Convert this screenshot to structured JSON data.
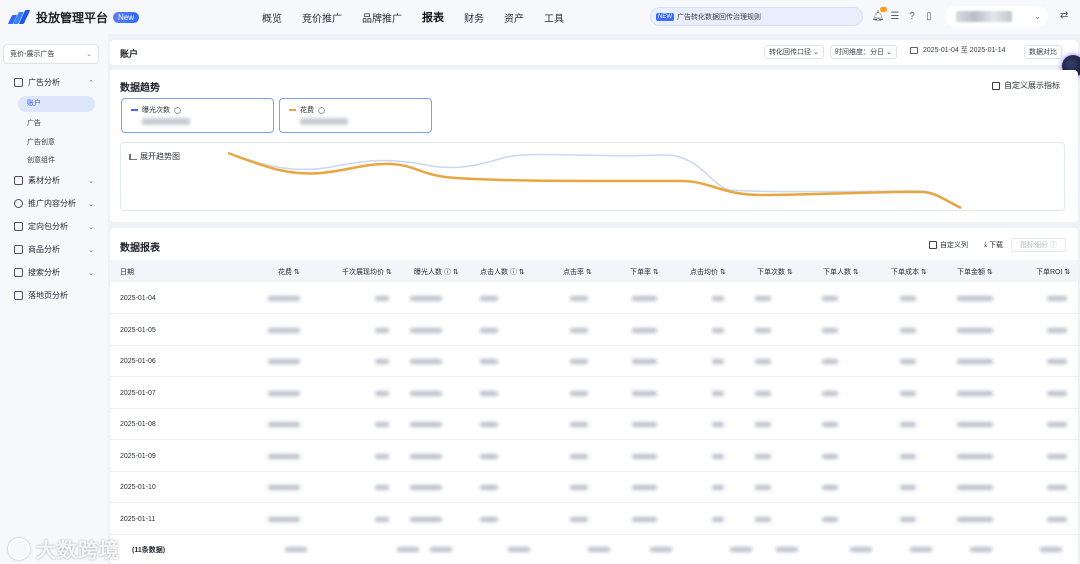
{
  "topbar": {
    "platform_name": "投放管理平台",
    "badge": "New",
    "nav": [
      "概览",
      "竞价推广",
      "品牌推广",
      "报表",
      "财务",
      "资产",
      "工具"
    ],
    "active_nav": "报表",
    "notice_tag": "NEW",
    "notice_text": "广告转化数据回传治理规则"
  },
  "sidebar": {
    "select_value": "竞价-展示广告",
    "groups": {
      "ad_analysis": "广告分析",
      "material_analysis": "素材分析",
      "content_analysis": "推广内容分析",
      "package_analysis": "定向包分析",
      "product_analysis": "商品分析",
      "search_analysis": "搜索分析",
      "landing_analysis": "落地页分析"
    },
    "subs": {
      "account": "账户",
      "ad": "广告",
      "creative": "广告创意",
      "component": "创意组件"
    }
  },
  "header": {
    "title": "账户",
    "caliber": "转化回传口径",
    "granularity": "时间维度：分日",
    "date_range": "2025-01-04 至 2025-01-14",
    "compare": "数据对比"
  },
  "trend": {
    "title": "数据趋势",
    "custom_metrics": "自定义展示指标",
    "metric1": "曝光次数",
    "metric2": "花费",
    "expand": "展开趋势图",
    "colors": {
      "line1": "#e9a640",
      "line2": "#c9d7f3"
    }
  },
  "table": {
    "title": "数据报表",
    "custom_columns": "自定义列",
    "download": "下载",
    "disabled_btn": "指标细分 ⓘ",
    "headers": [
      "日期",
      "花费",
      "千次展现均价",
      "曝光人数",
      "点击人数",
      "点击率",
      "下单率",
      "点击均价",
      "下单次数",
      "下单人数",
      "下单成本",
      "下单金额",
      "下单ROI"
    ],
    "dates": [
      "2025-01-04",
      "2025-01-05",
      "2025-01-06",
      "2025-01-07",
      "2025-01-08",
      "2025-01-09",
      "2025-01-10",
      "2025-01-11"
    ],
    "total_label": "(11条数据)"
  },
  "watermark": "大数跨境"
}
